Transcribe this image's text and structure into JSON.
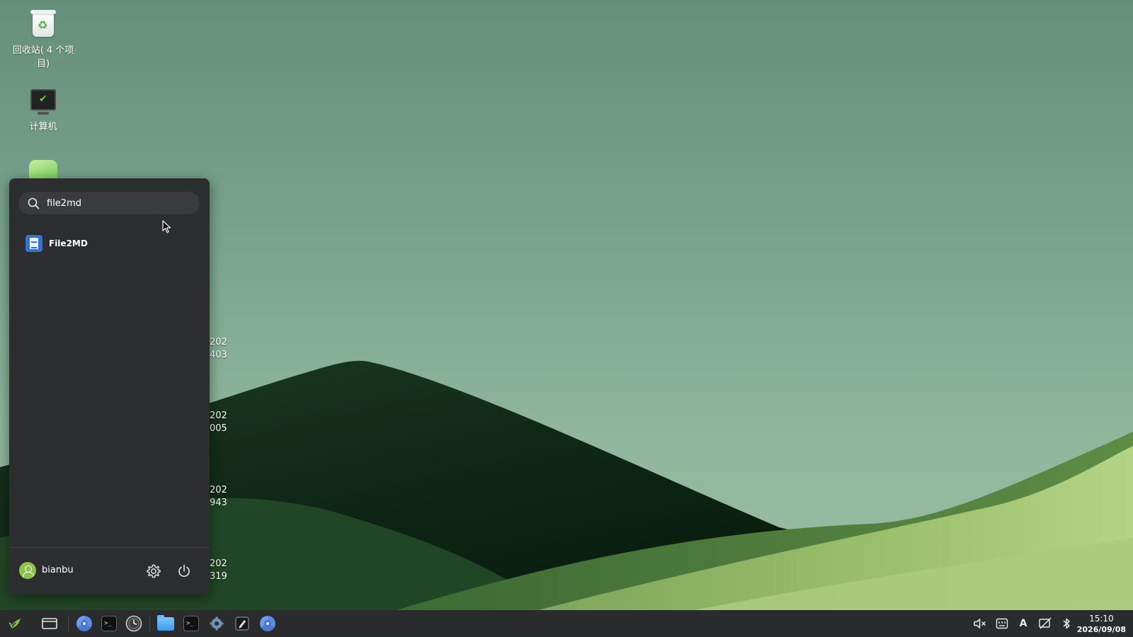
{
  "desktop": {
    "icons": [
      {
        "name": "recycle-bin",
        "label": "回收站( 4 个项目)"
      },
      {
        "name": "computer",
        "label": "计算机"
      }
    ],
    "partial_labels": [
      {
        "line1": "202",
        "line2": "403"
      },
      {
        "line1": "202",
        "line2": "005"
      },
      {
        "line1": "202",
        "line2": "943"
      },
      {
        "line1": "202",
        "line2": "319"
      }
    ]
  },
  "start_menu": {
    "search": {
      "value": "file2md",
      "placeholder": ""
    },
    "results": [
      {
        "label": "File2MD",
        "icon": "document-icon"
      }
    ],
    "user": {
      "name": "bianbu"
    },
    "footer_icons": [
      "gear-icon",
      "power-icon"
    ]
  },
  "taskbar": {
    "start_icon": "leaf-logo-icon",
    "apps": [
      "window-icon",
      "chromium-icon",
      "terminal-icon",
      "clock-icon",
      "file-manager-icon",
      "terminal-icon",
      "settings-icon",
      "editor-icon",
      "chromium-icon"
    ],
    "tray": {
      "icons": [
        "volume-muted-icon",
        "keyboard-icon",
        "input-method-icon",
        "network-off-icon",
        "bluetooth-icon"
      ],
      "input_method_label": "A",
      "time": "15:10",
      "date": "2026/09/08"
    }
  },
  "colors": {
    "menu_bg": "#2c2d2f",
    "taskbar_bg": "#2a2b2d",
    "accent_green": "#8bc34a",
    "accent_blue": "#2f74d8"
  }
}
